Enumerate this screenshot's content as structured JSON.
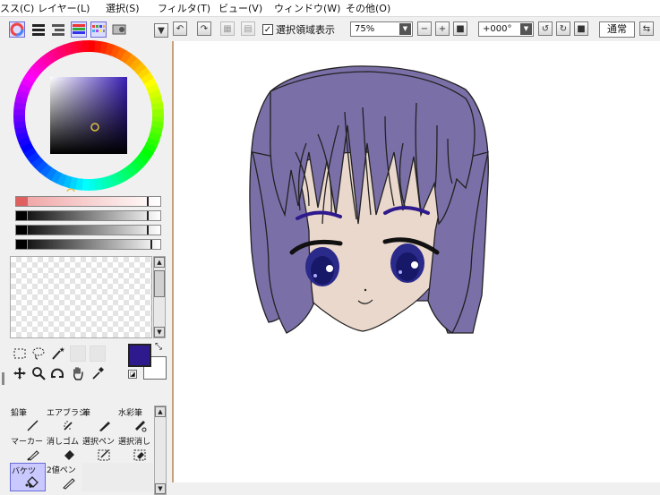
{
  "menubar": {
    "items": [
      "スス(C)",
      "レイヤー(L)",
      "選択(S)",
      "フィルタ(T)",
      "ビュー(V)",
      "ウィンドウ(W)",
      "その他(O)"
    ]
  },
  "toolbar": {
    "selection_display_label": "選択領域表示",
    "selection_display_checked": "✓",
    "zoom_value": "75%",
    "rotation_value": "+000°",
    "blend_mode": "通常"
  },
  "color": {
    "primary": "#2e1a8c",
    "secondary": "#ffffff",
    "hsv_square_hue": "#3a1fb5",
    "hair": "#7b6fa8",
    "skin": "#ead8cc"
  },
  "sliders": [
    {
      "name": "hue",
      "value": 0.9
    },
    {
      "name": "saturation",
      "value": 0.9
    },
    {
      "name": "value",
      "value": 0.9
    },
    {
      "name": "opacity",
      "value": 0.95
    }
  ],
  "brushes": [
    {
      "label": "鉛筆",
      "icon": "pencil-icon"
    },
    {
      "label": "エアブラシ",
      "icon": "airbrush-icon"
    },
    {
      "label": "筆",
      "icon": "brush-icon"
    },
    {
      "label": "水彩筆",
      "icon": "watercolor-icon"
    },
    {
      "label": "マーカー",
      "icon": "marker-icon"
    },
    {
      "label": "消しゴム",
      "icon": "eraser-icon"
    },
    {
      "label": "選択ペン",
      "icon": "select-pen-icon"
    },
    {
      "label": "選択消し",
      "icon": "select-eraser-icon"
    },
    {
      "label": "バケツ",
      "icon": "bucket-icon"
    },
    {
      "label": "2値ペン",
      "icon": "binary-pen-icon"
    }
  ]
}
